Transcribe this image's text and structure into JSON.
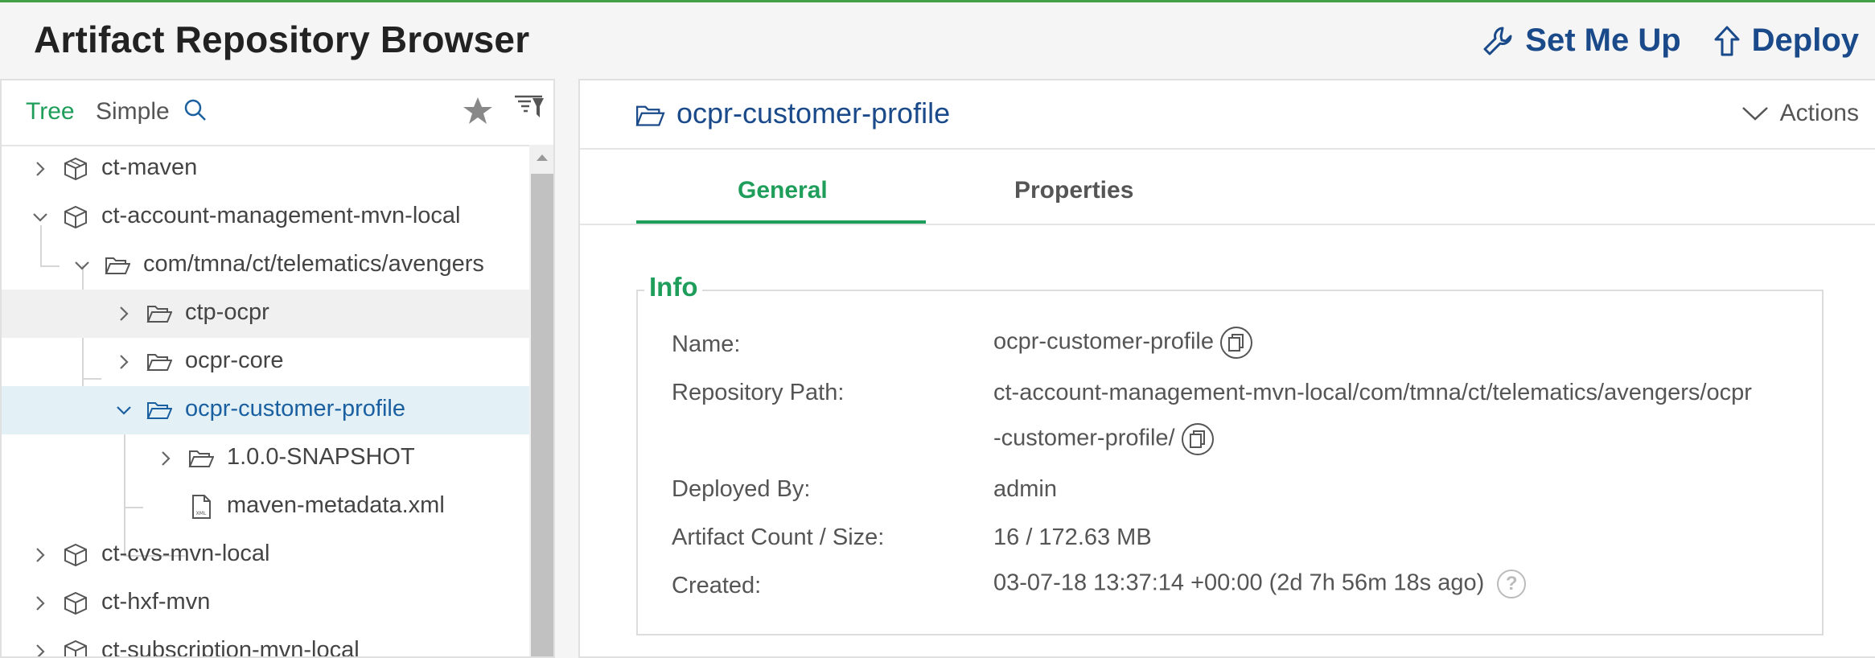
{
  "header": {
    "title": "Artifact Repository Browser",
    "set_me_up": "Set Me Up",
    "deploy": "Deploy"
  },
  "left": {
    "tab_tree": "Tree",
    "tab_simple": "Simple",
    "tree": [
      {
        "label": "ct-maven",
        "icon": "package-icon",
        "expanded": false
      },
      {
        "label": "ct-account-management-mvn-local",
        "icon": "package-icon",
        "expanded": true
      },
      {
        "label": "com/tmna/ct/telematics/avengers",
        "icon": "folder-icon",
        "expanded": true
      },
      {
        "label": "ctp-ocpr",
        "icon": "folder-icon",
        "expanded": false
      },
      {
        "label": "ocpr-core",
        "icon": "folder-icon",
        "expanded": false
      },
      {
        "label": "ocpr-customer-profile",
        "icon": "folder-icon",
        "expanded": true,
        "selected": true
      },
      {
        "label": "1.0.0-SNAPSHOT",
        "icon": "folder-icon",
        "expanded": false
      },
      {
        "label": "maven-metadata.xml",
        "icon": "xml-file-icon"
      },
      {
        "label": "ct-cvs-mvn-local",
        "icon": "package-icon",
        "expanded": false
      },
      {
        "label": "ct-hxf-mvn",
        "icon": "package-icon",
        "expanded": false
      },
      {
        "label": "ct-subscription-mvn-local",
        "icon": "package-icon",
        "expanded": false
      }
    ]
  },
  "right": {
    "title": "ocpr-customer-profile",
    "actions": "Actions",
    "tab_general": "General",
    "tab_properties": "Properties",
    "info_legend": "Info",
    "info": {
      "name_label": "Name:",
      "name_value": "ocpr-customer-profile",
      "path_label": "Repository Path:",
      "path_value_line1": "ct-account-management-mvn-local/com/tmna/ct/telematics/avengers/ocpr",
      "path_value_line2": "-customer-profile/",
      "deployed_label": "Deployed By:",
      "deployed_value": "admin",
      "count_label": "Artifact Count / Size:",
      "count_value": "16 / 172.63 MB",
      "created_label": "Created:",
      "created_value": "03-07-18 13:37:14 +00:00 (2d 7h 56m 18s ago)"
    }
  },
  "colors": {
    "accent_green": "#1e9e5a",
    "link_blue": "#1a4a8a",
    "selected_bg": "#e3f1f6"
  }
}
